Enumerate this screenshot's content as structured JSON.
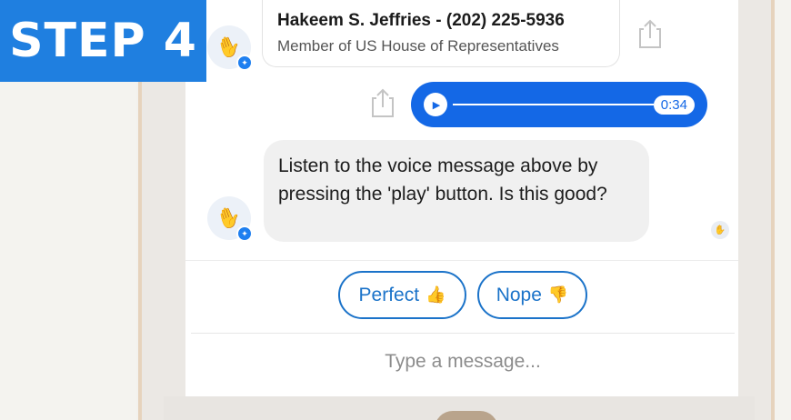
{
  "step_badge": "STEP 4",
  "contact": {
    "name": "Hakeem S. Jeffries - (202) 225-5936",
    "role": "Member of US House of Representatives"
  },
  "voice_message": {
    "duration": "0:34"
  },
  "bot_message": "Listen to the voice message above by pressing the 'play' button. Is this good?",
  "quick_replies": [
    {
      "label": "Perfect",
      "emoji": "👍"
    },
    {
      "label": "Nope",
      "emoji": "👎"
    }
  ],
  "composer": {
    "placeholder": "Type a message..."
  },
  "icons": {
    "avatar": "thumbs-up-hand-icon",
    "badge": "messenger-icon",
    "share": "share-icon",
    "play": "play-icon"
  },
  "colors": {
    "step_badge": "#1f7fe0",
    "voice_bubble": "#1468e6",
    "quick_reply_border": "#1b73c9"
  }
}
